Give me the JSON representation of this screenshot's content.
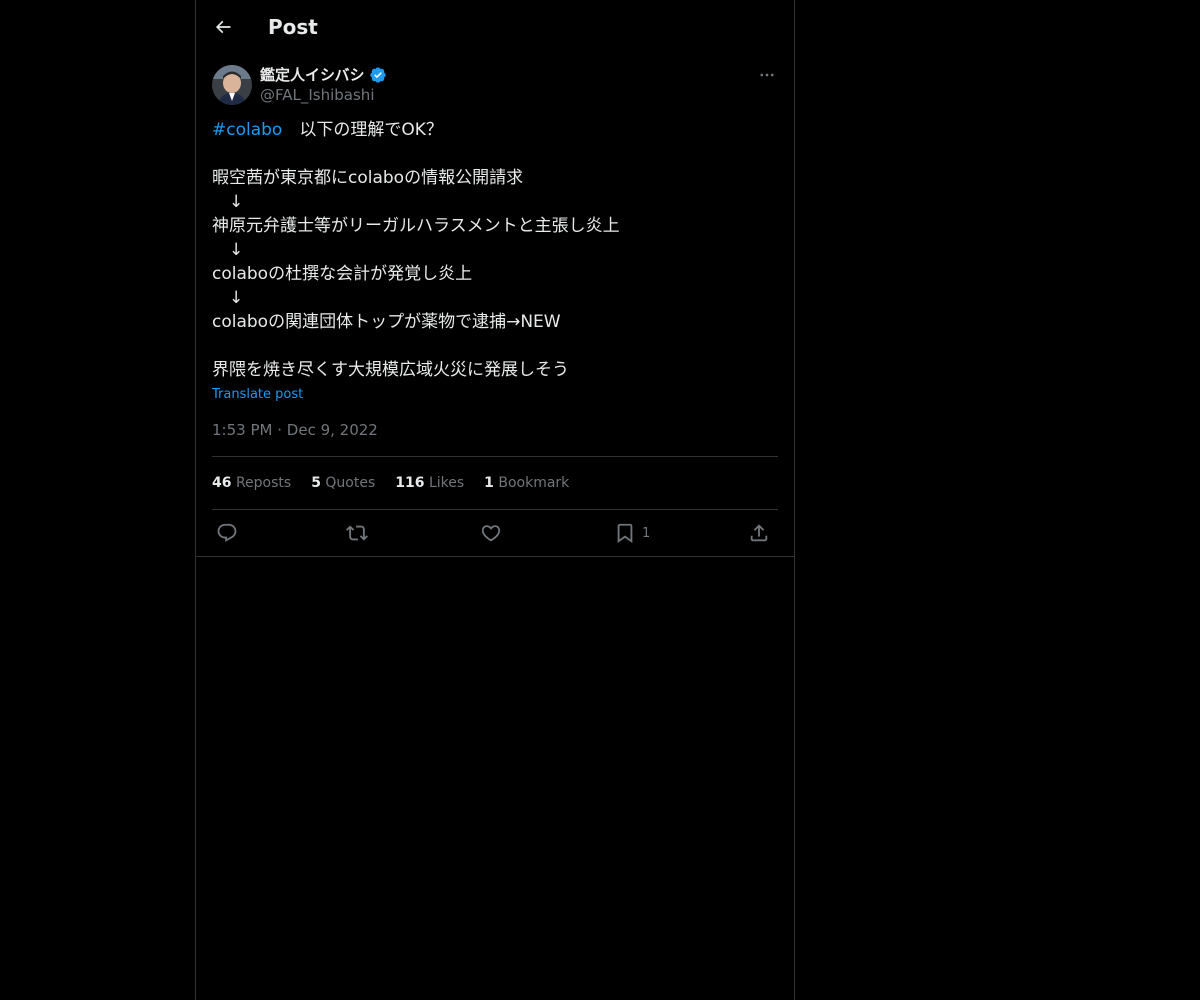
{
  "header": {
    "title": "Post",
    "back_icon": "arrow-left-icon"
  },
  "author": {
    "name": "鑑定人イシバシ",
    "handle": "@FAL_Ishibashi",
    "verified": true,
    "verified_color": "#1d9bf0"
  },
  "post": {
    "hashtag": "#colabo",
    "first_line_rest": "　以下の理解でOK？",
    "lines": [
      "",
      "暇空茜が東京都にcolaboの情報公開請求",
      "　↓",
      "神原元弁護士等がリーガルハラスメントと主張し炎上",
      "　↓",
      "colaboの杜撰な会計が発覚し炎上",
      "　↓",
      "colaboの関連団体トップが薬物で逮捕→NEW",
      "",
      "界隈を焼き尽くす大規模広域火災に発展しそう"
    ],
    "translate_label": "Translate post",
    "time": "1:53 PM",
    "separator": "·",
    "date": "Dec 9, 2022"
  },
  "stats": {
    "reposts": {
      "count": "46",
      "label": "Reposts"
    },
    "quotes": {
      "count": "5",
      "label": "Quotes"
    },
    "likes": {
      "count": "116",
      "label": "Likes"
    },
    "bookmarks": {
      "count": "1",
      "label": "Bookmark"
    }
  },
  "actions": {
    "bookmark_count": "1"
  },
  "colors": {
    "background": "#000000",
    "text": "#e7e9ea",
    "muted": "#71767b",
    "accent": "#1d9bf0",
    "border": "#2f3336"
  }
}
